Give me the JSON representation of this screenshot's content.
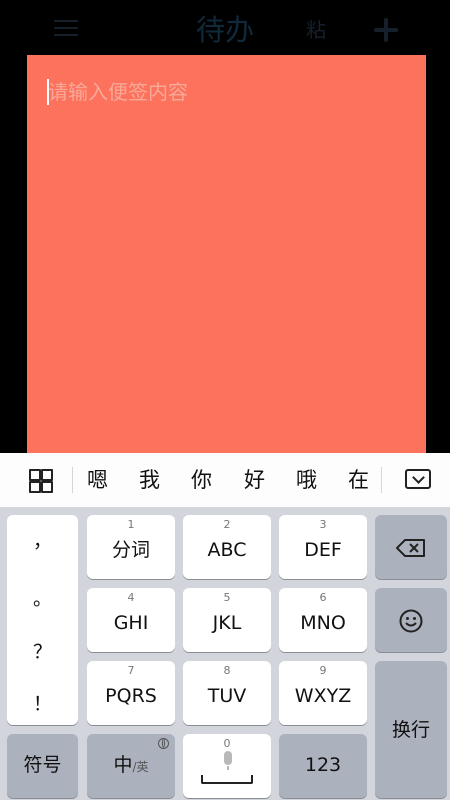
{
  "header": {
    "title": "待办",
    "paste_label": "粘"
  },
  "note": {
    "placeholder": "请输入便签内容",
    "background_color": "#fd725c"
  },
  "candidates": {
    "items": [
      "嗯",
      "我",
      "你",
      "好",
      "哦",
      "在"
    ]
  },
  "keyboard": {
    "punctuation": [
      "，",
      "。",
      "？",
      "！"
    ],
    "keys": [
      {
        "num": "1",
        "label": "分词"
      },
      {
        "num": "2",
        "label": "ABC"
      },
      {
        "num": "3",
        "label": "DEF"
      },
      {
        "num": "4",
        "label": "GHI"
      },
      {
        "num": "5",
        "label": "JKL"
      },
      {
        "num": "6",
        "label": "MNO"
      },
      {
        "num": "7",
        "label": "PQRS"
      },
      {
        "num": "8",
        "label": "TUV"
      },
      {
        "num": "9",
        "label": "WXYZ"
      }
    ],
    "symbol_label": "符号",
    "lang_main": "中",
    "lang_sub": "/英",
    "space_num": "0",
    "numbers_label": "123",
    "enter_label": "换行",
    "icons": [
      "menu-icon",
      "plus-icon",
      "grid-icon",
      "collapse-keyboard-icon",
      "backspace-icon",
      "smile-icon",
      "mic-icon",
      "globe-icon"
    ]
  }
}
